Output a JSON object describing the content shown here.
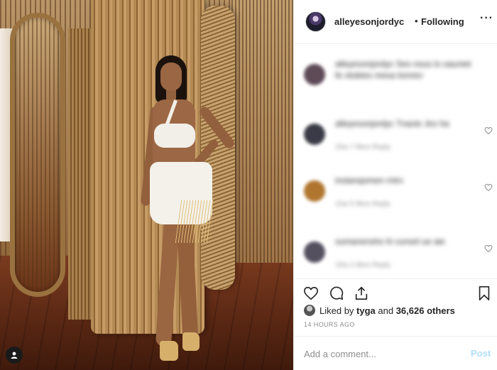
{
  "post": {
    "username": "alleyesonjordyc",
    "separator": "•",
    "follow_status": "Following",
    "more_icon": "more-options-icon",
    "more_glyph": "···"
  },
  "comments": [
    {
      "text": "alleyesonjordyc Ses nous lo oauniet fe otobies mesa tonnicr",
      "meta": "",
      "avatar_color": "#5f4a58",
      "heart": false
    },
    {
      "text": "alleyesonjordyc Tnavie Jes ha",
      "meta": "15w   7 likes   Reply",
      "avatar_color": "#3b3b47",
      "heart": true
    },
    {
      "text": "instanqomen rntrv",
      "meta": "15w   5 likes   Reply",
      "avatar_color": "#b0762f",
      "heart": true
    },
    {
      "text": "sumanenshs hi cunsel ue aie",
      "meta": "15w   2 likes   Reply",
      "avatar_color": "#555060",
      "heart": true
    }
  ],
  "actions": {
    "like_icon": "heart-icon",
    "comment_icon": "comment-icon",
    "share_icon": "share-icon",
    "save_icon": "bookmark-icon"
  },
  "likes": {
    "prefix": "Liked by ",
    "user": "tyga",
    "middle": " and ",
    "count": "36,626 others"
  },
  "timestamp": "14 HOURS AGO",
  "comment_box": {
    "placeholder": "Add a comment...",
    "post_label": "Post"
  },
  "colors": {
    "text": "#262626",
    "muted": "#8e8e8e",
    "post_disabled": "#b2dffc",
    "divider": "#efefef"
  }
}
